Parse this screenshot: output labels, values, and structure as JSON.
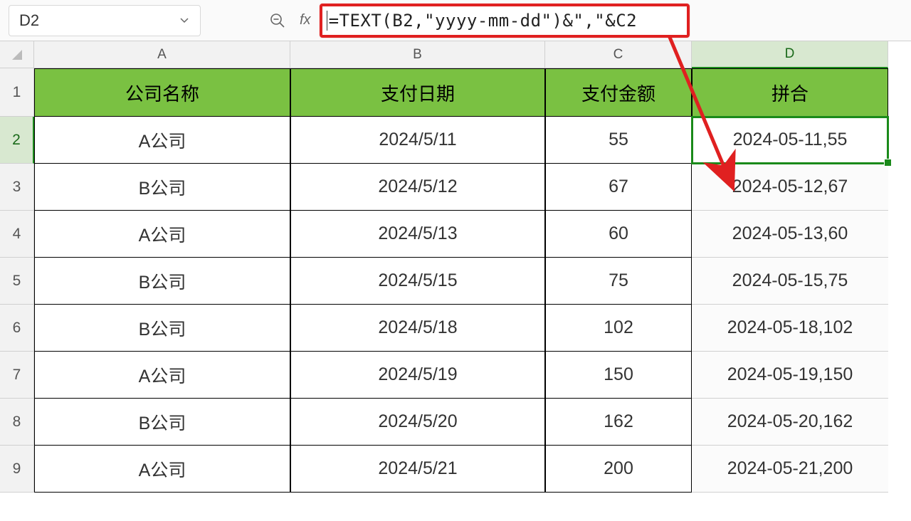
{
  "formula_bar": {
    "cell_ref": "D2",
    "fx_label": "fx",
    "formula": "=TEXT(B2,\"yyyy-mm-dd\")&\",\"&C2"
  },
  "columns": [
    "A",
    "B",
    "C",
    "D"
  ],
  "header_row": {
    "A": "公司名称",
    "B": "支付日期",
    "C": "支付金额",
    "D": "拼合"
  },
  "rows": [
    {
      "n": "2",
      "A": "A公司",
      "B": "2024/5/11",
      "C": "55",
      "D": "2024-05-11,55"
    },
    {
      "n": "3",
      "A": "B公司",
      "B": "2024/5/12",
      "C": "67",
      "D": "2024-05-12,67"
    },
    {
      "n": "4",
      "A": "A公司",
      "B": "2024/5/13",
      "C": "60",
      "D": "2024-05-13,60"
    },
    {
      "n": "5",
      "A": "B公司",
      "B": "2024/5/15",
      "C": "75",
      "D": "2024-05-15,75"
    },
    {
      "n": "6",
      "A": "B公司",
      "B": "2024/5/18",
      "C": "102",
      "D": "2024-05-18,102"
    },
    {
      "n": "7",
      "A": "A公司",
      "B": "2024/5/19",
      "C": "150",
      "D": "2024-05-19,150"
    },
    {
      "n": "8",
      "A": "B公司",
      "B": "2024/5/20",
      "C": "162",
      "D": "2024-05-20,162"
    },
    {
      "n": "9",
      "A": "A公司",
      "B": "2024/5/21",
      "C": "200",
      "D": "2024-05-21,200"
    }
  ],
  "selected_cell": "D2",
  "colors": {
    "header_bg": "#7ac142",
    "highlight": "#e02020",
    "selection": "#1a8a1a"
  }
}
